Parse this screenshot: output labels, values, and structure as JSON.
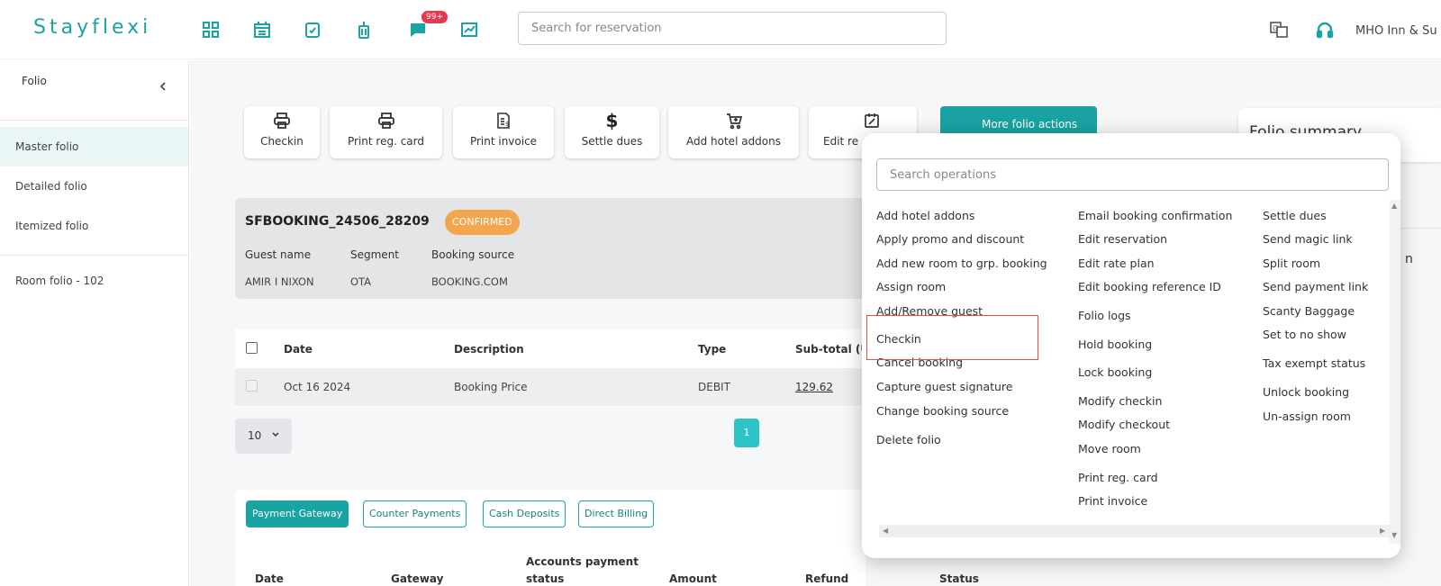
{
  "app": {
    "logo": "Stayflexi"
  },
  "topbar": {
    "notification_count": "99+",
    "search_placeholder": "Search for reservation",
    "hotel_name": "MHO Inn & Su"
  },
  "sidebar": {
    "title": "Folio",
    "items": [
      {
        "label": "Master folio",
        "active": true
      },
      {
        "label": "Detailed folio",
        "active": false
      },
      {
        "label": "Itemized folio",
        "active": false
      },
      {
        "label": "Room folio - 102",
        "active": false
      }
    ]
  },
  "actions": {
    "checkin": "Checkin",
    "print_reg_card": "Print reg. card",
    "print_invoice": "Print invoice",
    "settle_dues": "Settle dues",
    "add_hotel_addons": "Add hotel addons",
    "edit_res": "Edit re",
    "more_folio_actions": "More folio actions"
  },
  "folio_summary": {
    "title": "Folio summary"
  },
  "booking": {
    "id": "SFBOOKING_24506_28209",
    "status": "CONFIRMED",
    "guest_name_label": "Guest name",
    "segment_label": "Segment",
    "booking_source_label": "Booking source",
    "guest_name": "AMIR I NIXON",
    "segment": "OTA",
    "booking_source": "BOOKING.COM"
  },
  "table": {
    "headers": {
      "date": "Date",
      "description": "Description",
      "type": "Type",
      "subtotal": "Sub-total (U"
    },
    "rows": [
      {
        "date": "Oct 16 2024",
        "description": "Booking Price",
        "type": "DEBIT",
        "subtotal": "129.62"
      }
    ],
    "page_size": "10",
    "current_page": "1"
  },
  "payments": {
    "tabs": [
      {
        "label": "Payment Gateway",
        "active": true
      },
      {
        "label": "Counter Payments",
        "active": false
      },
      {
        "label": "Cash Deposits",
        "active": false
      },
      {
        "label": "Direct Billing",
        "active": false
      }
    ],
    "headers": {
      "date": "Date",
      "gateway": "Gateway",
      "accounts_status_1": "Accounts payment",
      "accounts_status_2": "status",
      "amount": "Amount",
      "refund": "Refund",
      "status": "Status"
    }
  },
  "operations": {
    "search_placeholder": "Search operations",
    "col1": [
      "Add hotel addons",
      "Apply promo and discount",
      "Add new room to grp. booking",
      "Assign room",
      "Add/Remove guest",
      "Checkin",
      "Cancel booking",
      "Capture guest signature",
      "Change booking source",
      "Delete folio"
    ],
    "col2": [
      "Email booking confirmation",
      "Edit reservation",
      "Edit rate plan",
      "Edit booking reference ID",
      "Folio logs",
      "Hold booking",
      "Lock booking",
      "Modify checkin",
      "Modify checkout",
      "Move room",
      "Print reg. card",
      "Print invoice"
    ],
    "col3": [
      "Settle dues",
      "Send magic link",
      "Split room",
      "Send payment link",
      "Scanty Baggage",
      "Set to no show",
      "Tax exempt status",
      "Unlock booking",
      "Un-assign room"
    ]
  },
  "colors": {
    "accent": "#1aa3a3",
    "badge": "#e53950",
    "status_confirmed": "#f2a64e",
    "highlight": "#e05050"
  }
}
